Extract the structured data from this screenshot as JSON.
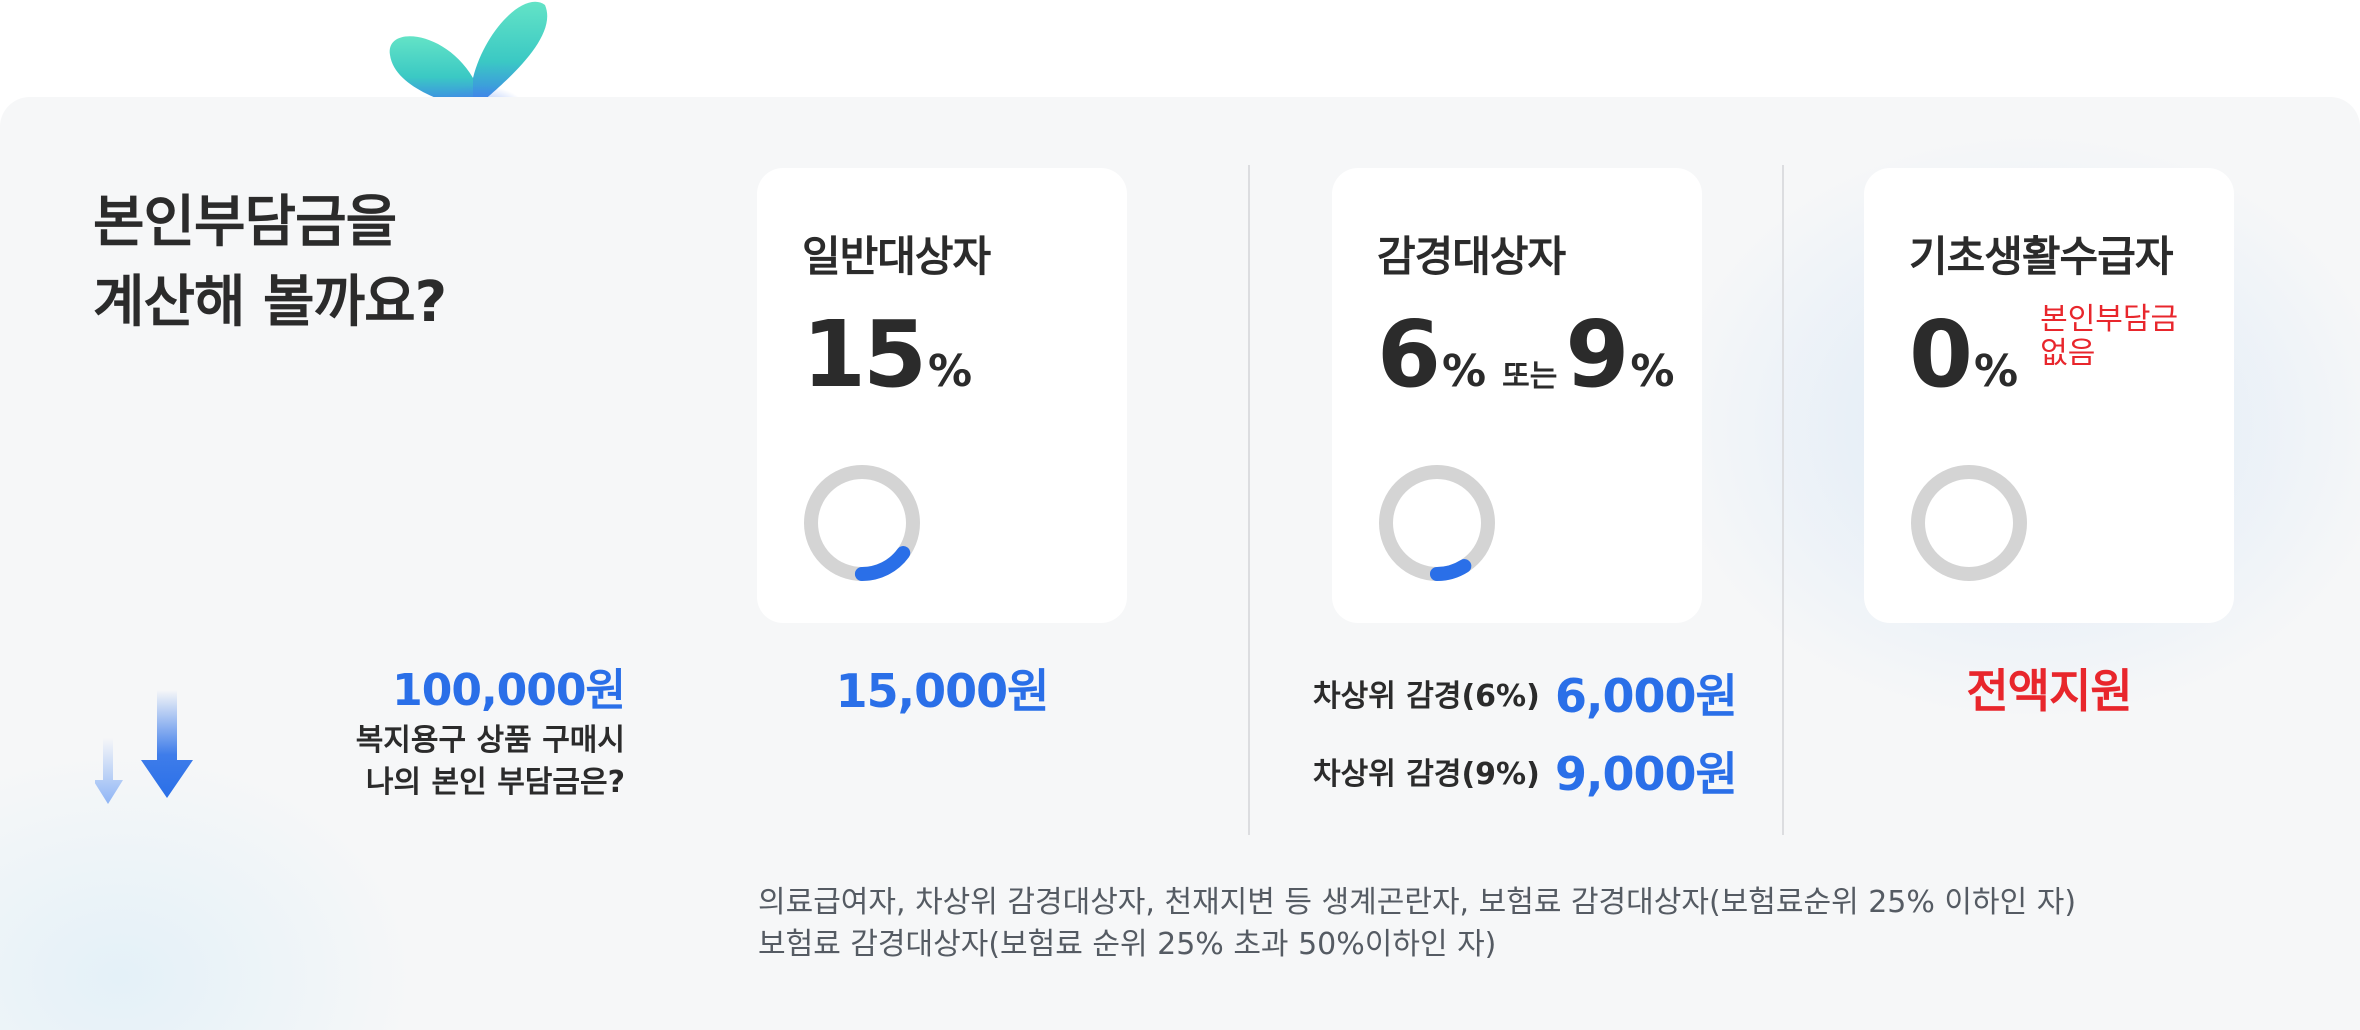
{
  "headline": {
    "line1": "본인부담금을",
    "line2": "계산해 볼까요?"
  },
  "calculator": {
    "amount": "100,000원",
    "desc_line1": "복지용구 상품 구매시",
    "desc_line2": "나의 본인 부담금은?"
  },
  "cards": [
    {
      "title": "일반대상자",
      "rate": "15",
      "percent_sign": "%",
      "share": 0.15,
      "result": "15,000원"
    },
    {
      "title": "감경대상자",
      "rate_a": "6",
      "percent_sign": "%",
      "or_label": "또는",
      "rate_b": "9",
      "share": 0.09,
      "results": [
        {
          "label": "차상위 감경(6%)",
          "amount": "6,000원"
        },
        {
          "label": "차상위 감경(9%)",
          "amount": "9,000원"
        }
      ]
    },
    {
      "title": "기초생활수급자",
      "rate": "0",
      "percent_sign": "%",
      "note_line1": "본인부담금",
      "note_line2": "없음",
      "share": 0,
      "result": "전액지원"
    }
  ],
  "footnote": {
    "line1": "의료급여자, 차상위 감경대상자, 천재지변 등 생계곤란자, 보험료 감경대상자(보험료순위 25% 이하인 자)",
    "line2": "보험료 감경대상자(보험료 순위 25% 초과 50%이하인 자)"
  },
  "colors": {
    "accent_blue": "#2a6fe8",
    "alert_red": "#e8262c",
    "donut_track": "#d4d4d4",
    "text_dark": "#2b2b2b"
  },
  "icons": {
    "top_decoration": "leaf-icon",
    "calculator": "down-arrows-icon"
  }
}
